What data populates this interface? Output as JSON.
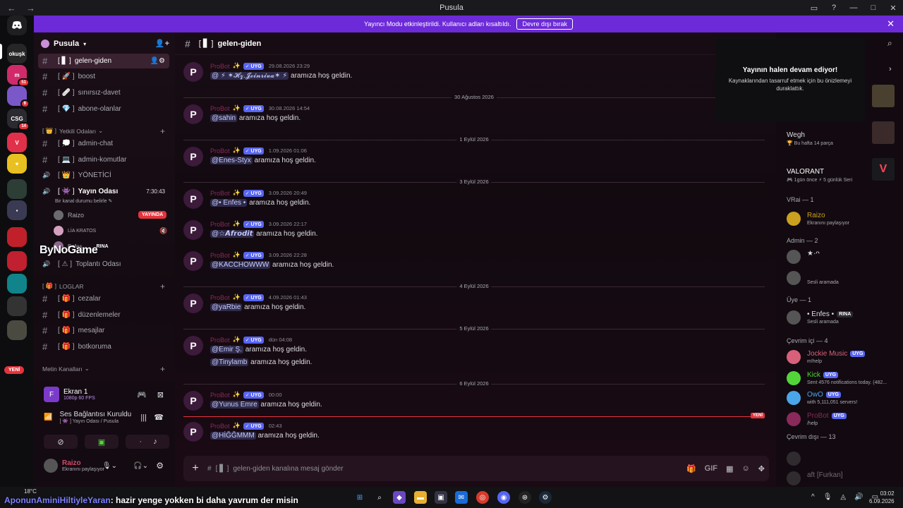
{
  "window": {
    "title": "Pusula",
    "back": "←",
    "forward": "→",
    "icons": [
      "▭",
      "?",
      "—",
      "□",
      "✕"
    ]
  },
  "banner": {
    "text": "Yayıncı Modu etkinleştirildi. Kullanıcı adları kısaltıldı.",
    "button": "Devre dışı bırak",
    "close": "✕"
  },
  "servers": [
    {
      "label": "",
      "color": "#1f1f22",
      "badge": ""
    },
    {
      "label": "okuşk",
      "color": "#262626",
      "badge": ""
    },
    {
      "label": "m",
      "color": "#d12a6a",
      "badge": "51"
    },
    {
      "label": "",
      "color": "#7a58c8",
      "badge": "6"
    },
    {
      "label": "CSG",
      "color": "#2a2a30",
      "badge": "14"
    },
    {
      "label": "V",
      "color": "#e0304a",
      "badge": ""
    },
    {
      "label": "♥",
      "color": "#e8c020",
      "badge": ""
    },
    {
      "label": "",
      "color": "#2c3e36",
      "badge": ""
    },
    {
      "label": "▪",
      "color": "#3a3a55",
      "badge": ""
    },
    {
      "label": "",
      "color": "#c0202a",
      "badge": ""
    },
    {
      "label": "",
      "color": "#c02030",
      "badge": ""
    },
    {
      "label": "",
      "color": "#11838a",
      "badge": ""
    },
    {
      "label": "",
      "color": "#333",
      "badge": ""
    },
    {
      "label": "",
      "color": "#4a4a40",
      "badge": ""
    }
  ],
  "servers_yeni": "YENİ",
  "sidebar": {
    "guild": "Pusula",
    "channels_top": [
      {
        "name": "gelen-giden",
        "prefix": "[ ▋ ]"
      },
      {
        "name": "boost",
        "prefix": "[ 🚀 ]"
      },
      {
        "name": "sınırsız-davet",
        "prefix": "[ 🩹 ]"
      },
      {
        "name": "abone-olanlar",
        "prefix": "[ 💎 ]"
      }
    ],
    "cat_yetkili": "Yetkili Odaları",
    "channels_yetkili": [
      {
        "name": "admin-chat",
        "prefix": "[ 💭 ]",
        "icon": "#"
      },
      {
        "name": "admin-komutlar",
        "prefix": "[ 💻 ]",
        "icon": "#"
      },
      {
        "name": "YÖNETİCİ",
        "prefix": "[ 👑 ]",
        "icon": "🔊"
      },
      {
        "name": "Yayın Odası",
        "prefix": "[ 👾 ]",
        "icon": "🔊"
      }
    ],
    "voice_timer": "7:30:43",
    "voice_status": "Bir kanal durumu belirle",
    "voice_users": [
      "Raizo",
      "LİA KRATOS",
      "Enfes"
    ],
    "live_badge": "YAYINDA",
    "rina_tag": "RINA",
    "meeting": {
      "name": "Toplantı Odası",
      "prefix": "[ ⚠ ]"
    },
    "cat_loglar": "LOGLAR",
    "channels_log": [
      {
        "name": "cezalar",
        "prefix": "[ 🎁 ]"
      },
      {
        "name": "düzenlemeler",
        "prefix": "[ 🎁 ]"
      },
      {
        "name": "mesajlar",
        "prefix": "[ 🎁 ]"
      },
      {
        "name": "botkoruma",
        "prefix": "[ 🎁 ]"
      }
    ],
    "cat_metin": "Metin Kanalları"
  },
  "panel": {
    "screen_label": "Ekran 1",
    "screen_sub": "1080p 60 FPS",
    "voice_title": "Ses Bağlantısı Kuruldu",
    "voice_sub": "[ 👾 ] Yayın Odası / Pusula",
    "user": "Raizo",
    "user_status": "Ekranını paylaşıyor"
  },
  "watermark": "ByNoGame",
  "chat": {
    "channel": "gelen-giden",
    "channel_prefix": "[ ▋ ]",
    "placeholder": "gelen-giden kanalına mesaj gönder",
    "bot": "ProBot",
    "bot_tag": "UYG",
    "new_label": "YENİ",
    "messages": [
      {
        "time": "29.08.2026 23:29",
        "mention": "@ ⚡ ✶𝓗𝔃.𝓙𝓸𝓲𝓷𝓻𝓲𝓿𝓪✶ ⚡",
        "text": "aramıza hoş geldin."
      },
      {
        "divider": "30 Ağustos 2026"
      },
      {
        "time": "30.08.2026 14:54",
        "mention": "@sahin",
        "text": "aramıza hoş geldin."
      },
      {
        "divider": "1 Eylül 2026"
      },
      {
        "time": "1.09.2026 01:06",
        "mention": "@Enes-Styx",
        "text": "aramıza hoş geldin."
      },
      {
        "divider": "3 Eylül 2026"
      },
      {
        "time": "3.09.2026 20:49",
        "mention": "@• Enfes •",
        "text": "aramıza hoş geldin."
      },
      {
        "time": "3.09.2026 22:17",
        "mention": "@☆𝘼𝙛𝙧𝙤𝙙𝙞𝙩",
        "text": "aramıza hoş geldin."
      },
      {
        "time": "3.09.2026 22:28",
        "mention": "@KACCHOWWW",
        "text": "aramıza hoş geldin."
      },
      {
        "divider": "4 Eylül 2026"
      },
      {
        "time": "4.09.2026 01:43",
        "mention": "@yaRbie",
        "text": "aramıza hoş geldin."
      },
      {
        "divider": "5 Eylül 2026"
      },
      {
        "time": "dün 04:08",
        "mention": "@Emir Ş.",
        "text": "aramıza hoş geldin.",
        "mention2": "@Tinylamb",
        "text2": "aramıza hoş geldin."
      },
      {
        "divider": "6 Eylül 2026"
      },
      {
        "time": "00:00",
        "mention": "@Yunus Emre",
        "text": "aramıza hoş geldin."
      },
      {
        "time": "02:43",
        "mention": "@HİĞĞMMM",
        "text": "aramıza hoş geldin."
      }
    ]
  },
  "popup": {
    "title": "Yayının halen devam ediyor!",
    "text": "Kaynaklarından tasarruf etmek için bu önizlemeyi duraklattık."
  },
  "members": {
    "activities": [
      {
        "name": "Wegh",
        "status": "Bu hafta 14 parça"
      },
      {
        "name": "VALORANT",
        "status": "1gün önce  ⚡ 5 günlük Seri"
      }
    ],
    "groups": [
      {
        "header": "VRai — 1",
        "list": [
          {
            "name": "Raizo",
            "status": "Ekranını paylaşıyor",
            "color": "#c9a020"
          }
        ]
      },
      {
        "header": "Admin — 2",
        "list": [
          {
            "name": "★·ᴖ",
            "status": ""
          },
          {
            "name": "",
            "status": "Sesli aramada"
          }
        ]
      },
      {
        "header": "Üye — 1",
        "list": [
          {
            "name": "• Enfes •",
            "status": "Sesli aramada",
            "tag": "RINA"
          }
        ]
      },
      {
        "header": "Çevrim içi — 4",
        "list": [
          {
            "name": "Jockie Music",
            "status": "m!help",
            "tag": "UYG",
            "color": "#d8607a"
          },
          {
            "name": "Kick",
            "status": "Sent 4576 notifications today. (482...",
            "tag": "UYG",
            "color": "#53d53a"
          },
          {
            "name": "OwO",
            "status": "with 5,111,051 servers!",
            "tag": "UYG",
            "color": "#4aa6e8"
          },
          {
            "name": "ProBot",
            "status": "/help",
            "tag": "UYG",
            "color": "#8a2a5a"
          }
        ]
      },
      {
        "header": "Çevrim dışı — 13",
        "list": [
          {
            "name": "",
            "status": ""
          },
          {
            "name": "aft [Furkan]",
            "status": ""
          }
        ]
      }
    ]
  },
  "taskbar": {
    "weather": "18°C",
    "ticker_user": "AponunAminiHiltiyleYaran",
    "ticker_text": ": hazir yenge yokken bi daha yavrum der misin",
    "time": "03:02",
    "date": "6.09.2026"
  }
}
